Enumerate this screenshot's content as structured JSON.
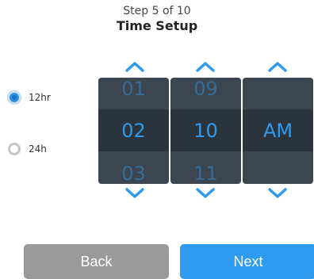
{
  "header": {
    "step": "Step 5 of 10",
    "title": "Time Setup"
  },
  "format_options": [
    {
      "label": "12hr",
      "selected": true
    },
    {
      "label": "24h",
      "selected": false
    }
  ],
  "picker": {
    "hour": {
      "prev": "01",
      "selected": "02",
      "next": "03"
    },
    "minute": {
      "prev": "09",
      "selected": "10",
      "next": "11"
    },
    "period": {
      "prev": "",
      "selected": "AM",
      "next": ""
    }
  },
  "buttons": {
    "back": "Back",
    "next": "Next"
  },
  "colors": {
    "accent": "#2f9bf0",
    "picker_bg": "#3b4650",
    "picker_band": "#2b343c",
    "back_button": "#9a9a9a"
  },
  "icons": {
    "up": "chevron-up-icon",
    "down": "chevron-down-icon"
  }
}
